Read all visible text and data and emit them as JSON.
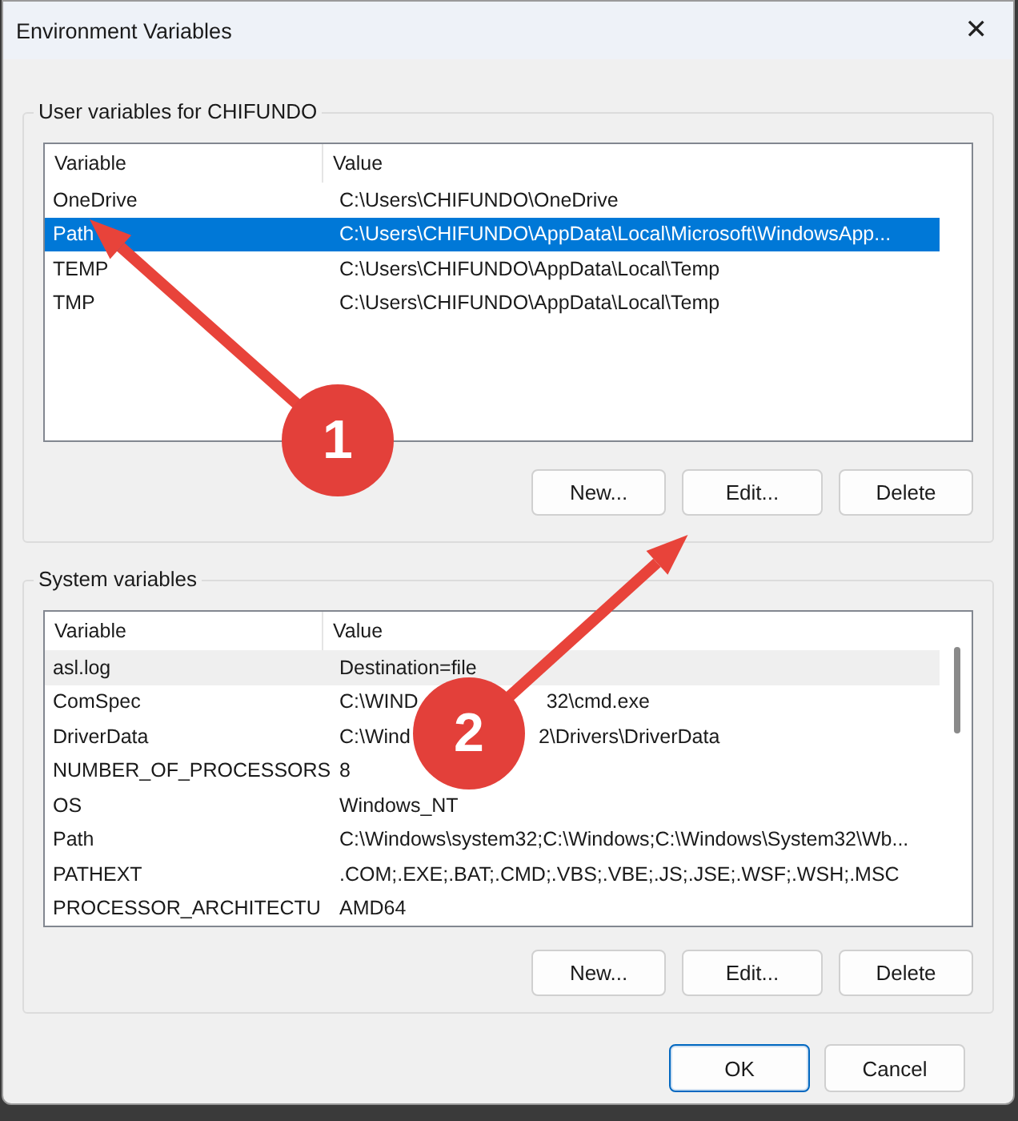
{
  "window": {
    "title": "Environment Variables",
    "close": "✕"
  },
  "user_group": {
    "title": "User variables for CHIFUNDO",
    "columns": [
      "Variable",
      "Value"
    ],
    "rows": [
      {
        "variable": "OneDrive",
        "value": "C:\\Users\\CHIFUNDO\\OneDrive",
        "selected": false,
        "hovered": false
      },
      {
        "variable": "Path",
        "value": "C:\\Users\\CHIFUNDO\\AppData\\Local\\Microsoft\\WindowsApp...",
        "selected": true,
        "hovered": false
      },
      {
        "variable": "TEMP",
        "value": "C:\\Users\\CHIFUNDO\\AppData\\Local\\Temp",
        "selected": false,
        "hovered": false
      },
      {
        "variable": "TMP",
        "value": "C:\\Users\\CHIFUNDO\\AppData\\Local\\Temp",
        "selected": false,
        "hovered": false
      }
    ],
    "buttons": [
      "New...",
      "Edit...",
      "Delete"
    ]
  },
  "system_group": {
    "title": "System variables",
    "columns": [
      "Variable",
      "Value"
    ],
    "rows": [
      {
        "variable": "asl.log",
        "value": "Destination=file",
        "selected": false,
        "hovered": true
      },
      {
        "variable": "ComSpec",
        "value": [
          "C:\\WIND",
          "32\\cmd.exe"
        ],
        "selected": false,
        "hovered": false
      },
      {
        "variable": "DriverData",
        "value": [
          "C:\\Wind",
          "2\\Drivers\\DriverData"
        ],
        "selected": false,
        "hovered": false
      },
      {
        "variable": "NUMBER_OF_PROCESSORS",
        "value": "8",
        "selected": false,
        "hovered": false
      },
      {
        "variable": "OS",
        "value": "Windows_NT",
        "selected": false,
        "hovered": false
      },
      {
        "variable": "Path",
        "value": "C:\\Windows\\system32;C:\\Windows;C:\\Windows\\System32\\Wb...",
        "selected": false,
        "hovered": false
      },
      {
        "variable": "PATHEXT",
        "value": ".COM;.EXE;.BAT;.CMD;.VBS;.VBE;.JS;.JSE;.WSF;.WSH;.MSC",
        "selected": false,
        "hovered": false
      },
      {
        "variable": "PROCESSOR_ARCHITECTU",
        "value": "AMD64",
        "selected": false,
        "hovered": false
      }
    ],
    "buttons": [
      "New...",
      "Edit...",
      "Delete"
    ]
  },
  "dialog_buttons": [
    {
      "label": "OK",
      "default": true
    },
    {
      "label": "Cancel",
      "default": false
    }
  ],
  "callouts": [
    "1",
    "2"
  ]
}
